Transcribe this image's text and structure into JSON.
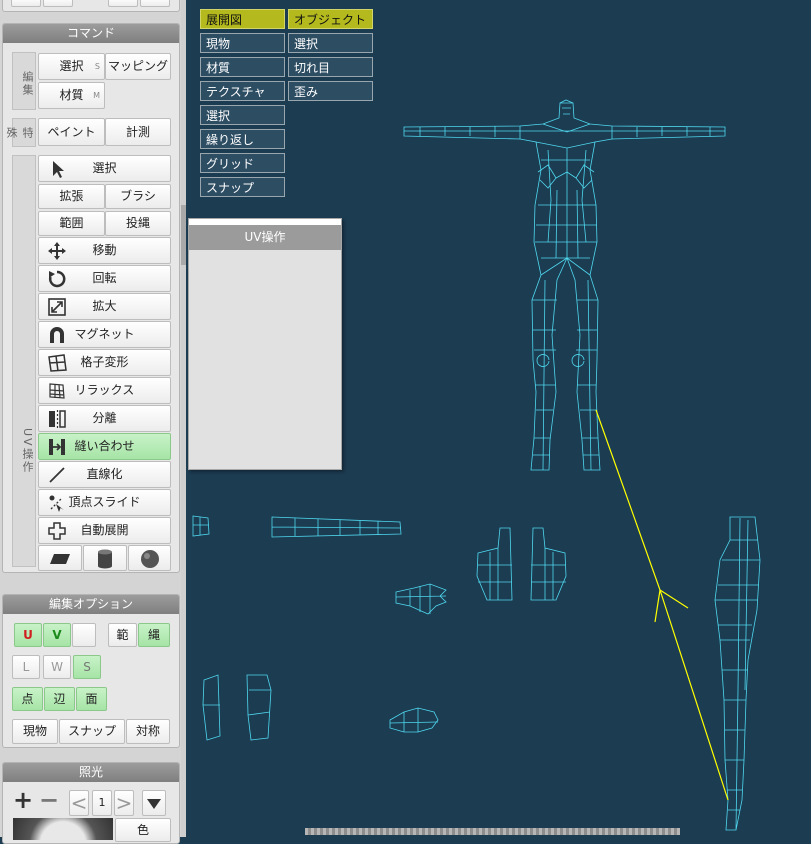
{
  "command_panel": {
    "title": "コマンド",
    "group_edit_label": "編集",
    "select_label": "選択",
    "select_shortcut": "S",
    "mapping_label": "マッピング",
    "material_label": "材質",
    "material_shortcut": "M",
    "group_special_label": "特殊",
    "paint_label": "ペイント",
    "measure_label": "計測",
    "group_uv_label": "UV操作",
    "tools": {
      "select": "選択",
      "expand": "拡張",
      "brush": "ブラシ",
      "range": "範囲",
      "lasso": "投縄",
      "move": "移動",
      "rotate": "回転",
      "scale": "拡大",
      "magnet": "マグネット",
      "lattice": "格子変形",
      "relax": "リラックス",
      "split": "分離",
      "stitch": "縫い合わせ",
      "straighten": "直線化",
      "vertex_slide": "頂点スライド",
      "auto_unwrap": "自動展開"
    }
  },
  "edit_options": {
    "title": "編集オプション",
    "u": "U",
    "v": "V",
    "range": "範",
    "lasso": "縄",
    "l": "L",
    "w": "W",
    "s": "S",
    "point": "点",
    "edge": "辺",
    "face": "面",
    "current": "現物",
    "snap": "スナップ",
    "symmetry": "対称"
  },
  "lighting": {
    "title": "照光",
    "page_number": "1",
    "color_label": "色"
  },
  "view_menu": {
    "unwrap": "展開図",
    "object": "オブジェクト",
    "current": "現物",
    "select2": "選択",
    "material": "材質",
    "seam": "切れ目",
    "texture": "テクスチャ",
    "distortion": "歪み",
    "select": "選択",
    "repeat": "繰り返し",
    "grid": "グリッド",
    "snap": "スナップ"
  },
  "uv_dialog": {
    "title": "UV操作"
  },
  "colors": {
    "viewport_bg": "#1c3c52",
    "wire": "#4fd8ee",
    "highlight_line": "#ffff00",
    "active_tab": "#b4ba1e",
    "active_button": "#a6e4a6"
  }
}
